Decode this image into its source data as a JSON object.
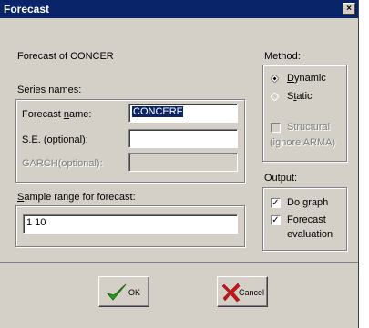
{
  "window": {
    "title": "Forecast",
    "close_glyph": "×"
  },
  "forecast_of": "Forecast of CONCER",
  "series_names": {
    "heading": "Series names:",
    "forecast_name_label_pre": "Forecast ",
    "forecast_name_label_ul": "n",
    "forecast_name_label_post": "ame:",
    "forecast_name_value": "CONCERF",
    "se_label_pre": "S.",
    "se_label_ul": "E",
    "se_label_post": ". (optional):",
    "se_value": "",
    "garch_label": "GARCH(optional):",
    "garch_value": ""
  },
  "sample": {
    "label_ul": "S",
    "label_post": "ample range for forecast:",
    "value": "1 10"
  },
  "method": {
    "heading": "Method:",
    "dynamic_ul": "D",
    "dynamic_post": "ynamic",
    "static_pre": "S",
    "static_ul": "t",
    "static_post": "atic",
    "structural_line1": "Structural",
    "structural_line2": "(ignore ARMA)",
    "selected": "Dynamic"
  },
  "output": {
    "heading": "Output:",
    "do_graph_pre": "Do ",
    "do_graph_ul": "g",
    "do_graph_post": "raph",
    "do_graph_checked": true,
    "fe_pre": "F",
    "fe_ul": "o",
    "fe_post": "recast",
    "fe_line2": "evaluation",
    "fe_checked": true
  },
  "buttons": {
    "ok": "OK",
    "cancel": "Cancel"
  },
  "colors": {
    "titlebar": "#0a246a",
    "face": "#d4d0c8",
    "ok_check": "#2e9e1e",
    "cancel_x": "#c81414"
  }
}
